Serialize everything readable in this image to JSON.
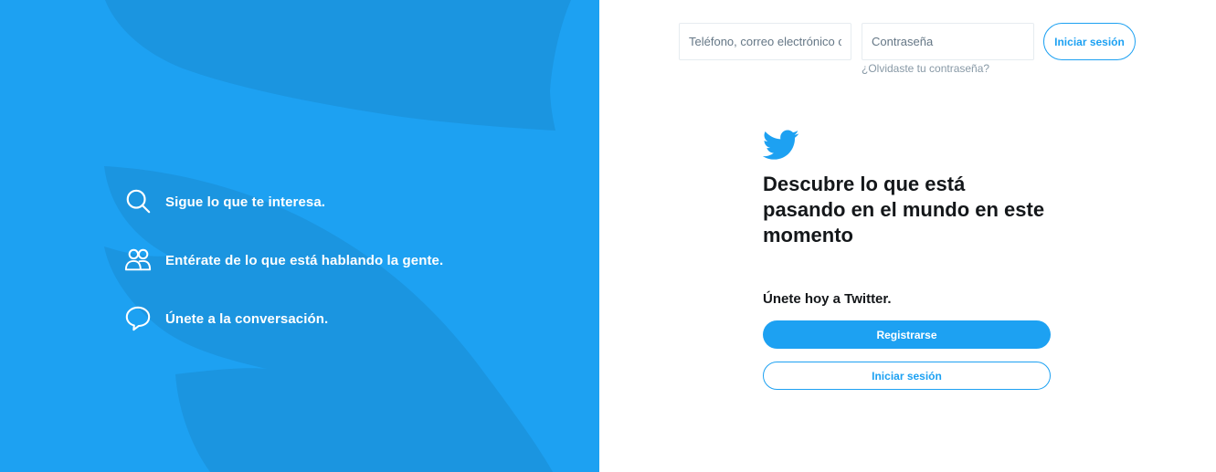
{
  "colors": {
    "brand_blue": "#1da1f2",
    "bird_shade": "#1b95e0",
    "text_dark": "#14171a",
    "muted": "#8899a6"
  },
  "left_panel": {
    "features": [
      {
        "icon": "search-icon",
        "text": "Sigue lo que te interesa."
      },
      {
        "icon": "people-icon",
        "text": "Entérate de lo que está hablando la gente."
      },
      {
        "icon": "speech-bubble-icon",
        "text": "Únete a la conversación."
      }
    ]
  },
  "login": {
    "phone_placeholder": "Teléfono, correo electrónico o nombre de usuario",
    "password_placeholder": "Contraseña",
    "submit_label": "Iniciar sesión",
    "forgot_label": "¿Olvidaste tu contraseña?"
  },
  "signup": {
    "logo_icon": "twitter-bird-icon",
    "headline": "Descubre lo que está pasando en el mundo en este momento",
    "join_text": "Únete hoy a Twitter.",
    "register_label": "Registrarse",
    "login_label": "Iniciar sesión"
  }
}
